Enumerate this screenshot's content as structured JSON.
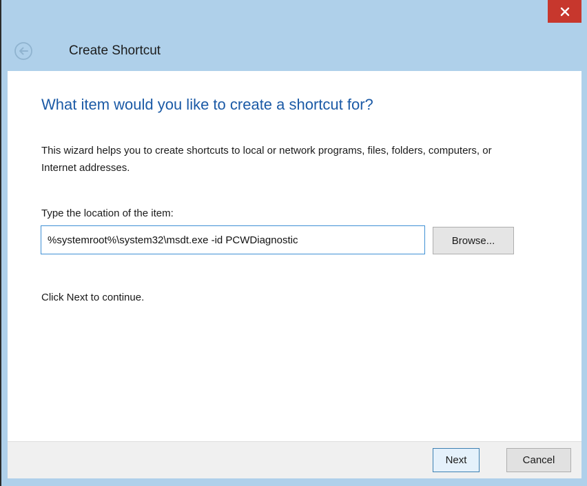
{
  "window": {
    "title": "Create Shortcut",
    "close_icon": "close-icon",
    "back_icon": "back-arrow-icon",
    "accent_color": "#afd0ea",
    "close_color": "#c7372d"
  },
  "main": {
    "heading": "What item would you like to create a shortcut for?",
    "description": "This wizard helps you to create shortcuts to local or network programs, files, folders, computers, or Internet addresses.",
    "location_label": "Type the location of the item:",
    "location_value": "%systemroot%\\system32\\msdt.exe -id PCWDiagnostic",
    "browse_label": "Browse...",
    "continue_text": "Click Next to continue."
  },
  "footer": {
    "next_label": "Next",
    "cancel_label": "Cancel"
  }
}
